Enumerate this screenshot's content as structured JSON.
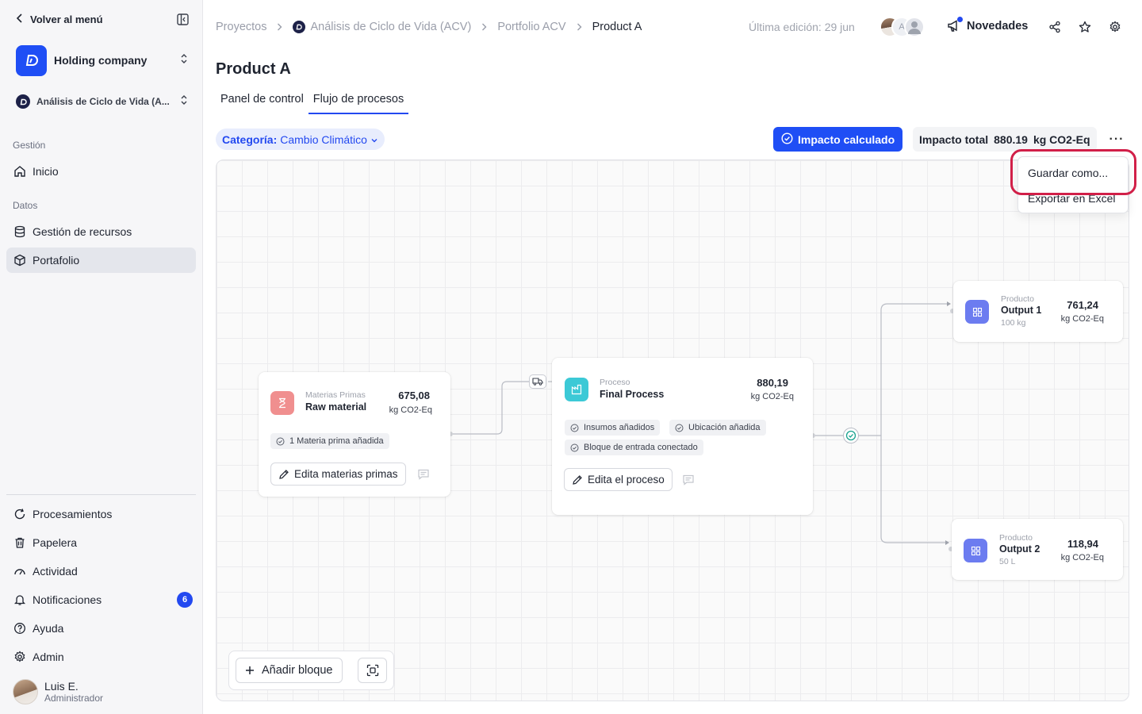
{
  "sidebar": {
    "back_label": "Volver al menú",
    "company_name": "Holding company",
    "project_name": "Análisis de Ciclo de Vida (A...",
    "sections": {
      "gestion": "Gestión",
      "datos": "Datos"
    },
    "items": {
      "inicio": "Inicio",
      "recursos": "Gestión de recursos",
      "portafolio": "Portafolio",
      "procesamientos": "Procesamientos",
      "papelera": "Papelera",
      "actividad": "Actividad",
      "notificaciones": "Notificaciones",
      "ayuda": "Ayuda",
      "admin": "Admin"
    },
    "notifications_count": "6",
    "user": {
      "name": "Luis E.",
      "role": "Administrador"
    }
  },
  "header": {
    "breadcrumb": [
      "Proyectos",
      "Análisis de Ciclo de Vida (ACV)",
      "Portfolio ACV",
      "Product A"
    ],
    "last_edit": "Última edición: 29 jun",
    "avatar_initial": "A",
    "news_label": "Novedades"
  },
  "page": {
    "title": "Product A",
    "tabs": [
      "Panel de control",
      "Flujo de procesos"
    ],
    "filter": {
      "label": "Categoría:",
      "value": "Cambio Climático"
    },
    "impact_button": "Impacto calculado",
    "total_label": "Impacto total",
    "total_value": "880.19",
    "total_unit": "kg CO2-Eq",
    "more_label": "···"
  },
  "dropdown": {
    "items": [
      "Guardar como...",
      "Exportar en Excel"
    ]
  },
  "flow": {
    "raw": {
      "kicker": "Materias Primas",
      "title": "Raw material",
      "value": "675,08",
      "unit": "kg CO2-Eq",
      "chip": "1 Materia prima añadida",
      "button": "Edita materias primas"
    },
    "process": {
      "kicker": "Proceso",
      "title": "Final Process",
      "value": "880,19",
      "unit": "kg CO2-Eq",
      "chips": [
        "Insumos añadidos",
        "Ubicación añadida",
        "Bloque de entrada conectado"
      ],
      "button": "Edita el proceso"
    },
    "outputs": [
      {
        "kicker": "Producto",
        "title": "Output 1",
        "sub": "100 kg",
        "value": "761,24",
        "unit": "kg CO2-Eq"
      },
      {
        "kicker": "Producto",
        "title": "Output 2",
        "sub": "50 L",
        "value": "118,94",
        "unit": "kg CO2-Eq"
      }
    ],
    "add_block": "Añadir bloque"
  },
  "colors": {
    "accent": "#1f4ef5",
    "highlight": "#d11f48",
    "raw_icon": "#f08f8f",
    "process_icon": "#3cc9d6",
    "output_icon": "#6c7cf0"
  }
}
